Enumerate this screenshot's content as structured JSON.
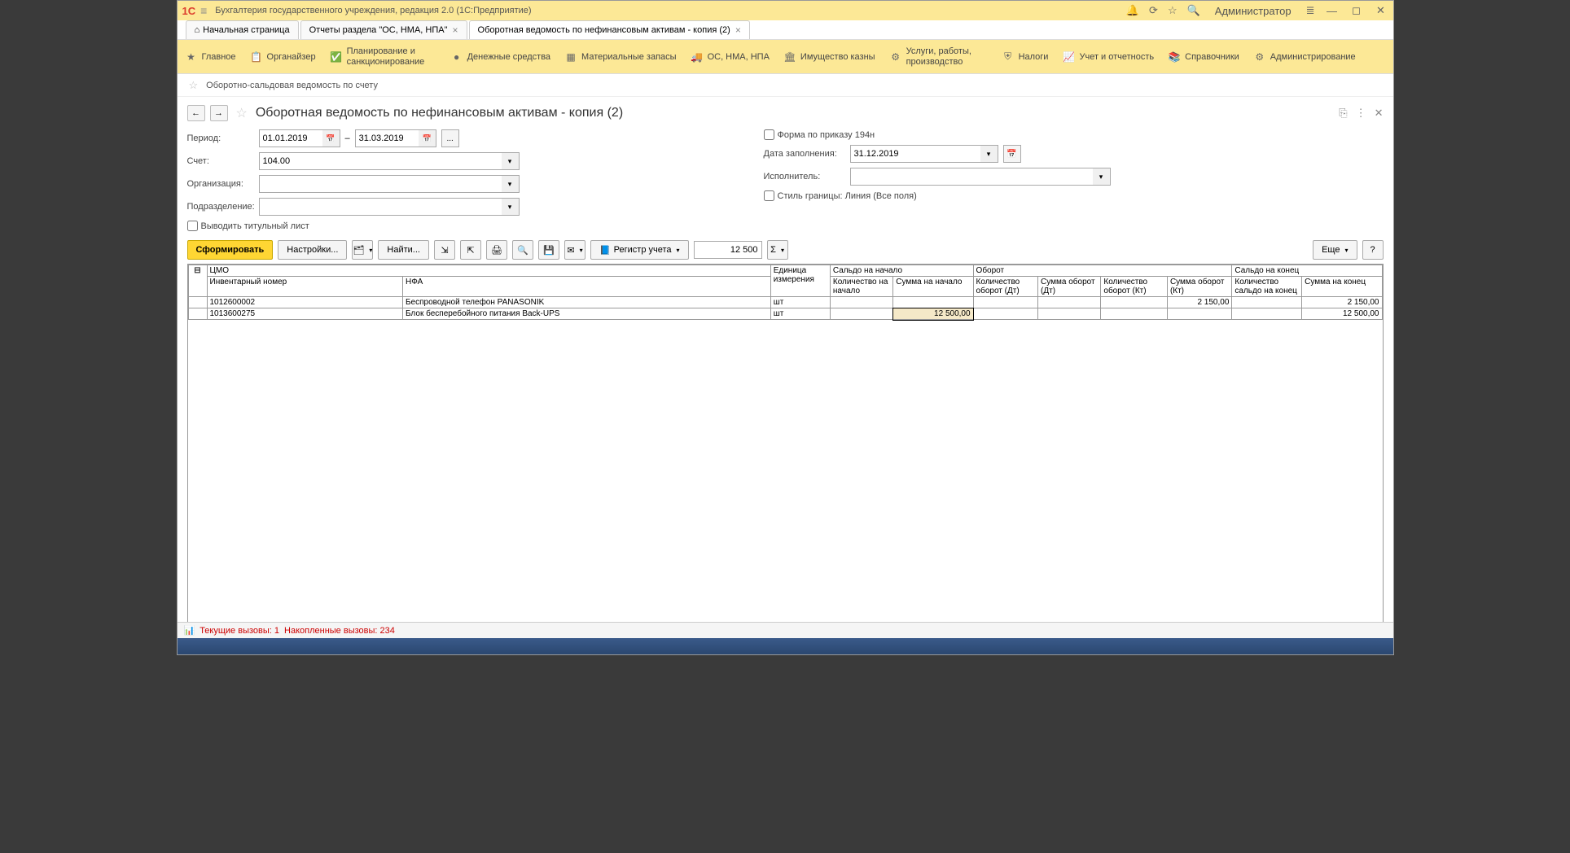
{
  "titlebar": {
    "logo": "1С",
    "title": "Бухгалтерия государственного учреждения, редакция 2.0  (1С:Предприятие)",
    "user": "Администратор"
  },
  "tabs": {
    "home": "Начальная страница",
    "reports": "Отчеты раздела \"ОС, НМА, НПА\"",
    "current": "Оборотная ведомость по нефинансовым активам - копия (2)"
  },
  "menu": {
    "main": "Главное",
    "organizer": "Органайзер",
    "planning": "Планирование и санкционирование",
    "money": "Денежные средства",
    "materials": "Материальные запасы",
    "os": "ОС, НМА, НПА",
    "property": "Имущество казны",
    "services": "Услуги, работы, производство",
    "taxes": "Налоги",
    "reports": "Учет и отчетность",
    "catalogs": "Справочники",
    "admin": "Администрирование"
  },
  "subbar": {
    "osv": "Оборотно-сальдовая ведомость по счету"
  },
  "page": {
    "title": "Оборотная ведомость по нефинансовым активам - копия (2)"
  },
  "form": {
    "period_label": "Период:",
    "date_from": "01.01.2019",
    "date_sep": "–",
    "date_to": "31.03.2019",
    "dots": "...",
    "account_label": "Счет:",
    "account": "104.00",
    "org_label": "Организация:",
    "dept_label": "Подразделение:",
    "show_title": "Выводить титульный лист",
    "form194": "Форма по приказу 194н",
    "fill_date_label": "Дата заполнения:",
    "fill_date": "31.12.2019",
    "executor_label": "Исполнитель:",
    "border_style": "Стиль границы: Линия (Все поля)"
  },
  "toolbar": {
    "generate": "Сформировать",
    "settings": "Настройки...",
    "find": "Найти...",
    "register": "Регистр учета",
    "num_value": "12 500",
    "sigma": "Σ",
    "more": "Еще",
    "help": "?"
  },
  "table": {
    "headers": {
      "cmo": "ЦМО",
      "inv": "Инвентарный номер",
      "nfa": "НФА",
      "unit": "Единица измерения",
      "saldo_start": "Сальдо на начало",
      "qty_start": "Количество на начало",
      "sum_start": "Сумма на начало",
      "turnover": "Оборот",
      "qty_dt": "Количество оборот (Дт)",
      "sum_dt": "Сумма оборот (Дт)",
      "qty_kt": "Количество оборот (Кт)",
      "sum_kt": "Сумма оборот (Кт)",
      "saldo_end": "Сальдо на конец",
      "qty_end": "Количество сальдо на конец",
      "sum_end": "Сумма на конец"
    },
    "rows": [
      {
        "inv": "1012600002",
        "nfa": "Беспроводной телефон PANASONIK",
        "unit": "шт",
        "qty_start": "",
        "sum_start": "",
        "qty_dt": "",
        "sum_dt": "",
        "qty_kt": "",
        "sum_kt": "2 150,00",
        "qty_end": "",
        "sum_end": "2 150,00"
      },
      {
        "inv": "1013600275",
        "nfa": "Блок бесперебойного питания Back-UPS",
        "unit": "шт",
        "qty_start": "",
        "sum_start": "12 500,00",
        "qty_dt": "",
        "sum_dt": "",
        "qty_kt": "",
        "sum_kt": "",
        "qty_end": "",
        "sum_end": "12 500,00"
      }
    ]
  },
  "status": {
    "current_calls_label": "Текущие вызовы:",
    "current_calls": "1",
    "accum_calls_label": "Накопленные вызовы:",
    "accum_calls": "234"
  }
}
